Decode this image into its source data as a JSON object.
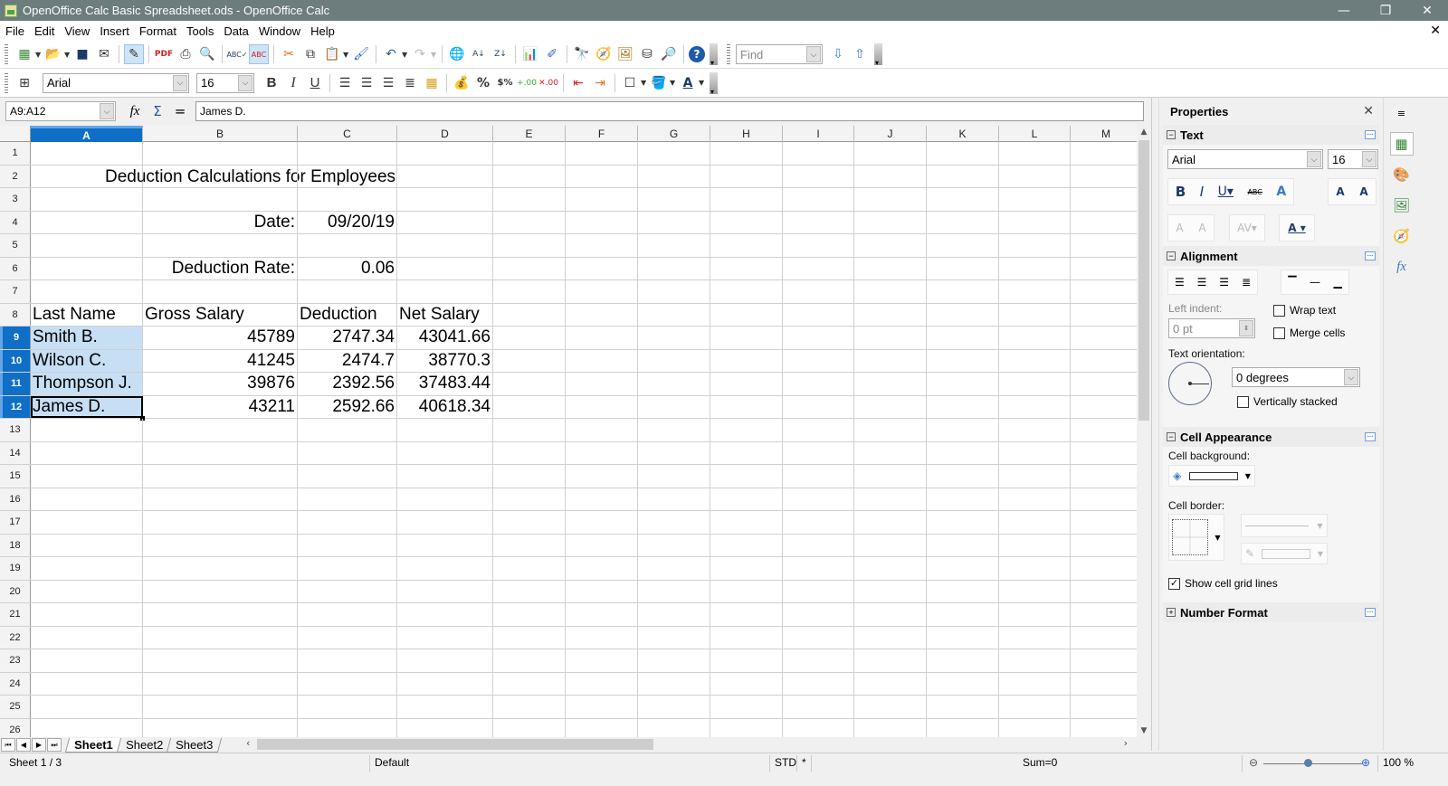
{
  "window": {
    "title": "OpenOffice Calc Basic Spreadsheet.ods - OpenOffice Calc",
    "minimize": "—",
    "restore": "❐",
    "close": "✕",
    "doc_close": "✕"
  },
  "menu": [
    "File",
    "Edit",
    "View",
    "Insert",
    "Format",
    "Tools",
    "Data",
    "Window",
    "Help"
  ],
  "toolbar_standard": {
    "icons": [
      "new-icon",
      "open-icon",
      "save-icon",
      "email-icon",
      "edit-mode-icon",
      "export-pdf-icon",
      "print-icon",
      "print-preview-icon",
      "spellcheck-icon",
      "autospellcheck-icon",
      "cut-icon",
      "copy-icon",
      "paste-icon",
      "format-paintbrush-icon",
      "undo-icon",
      "redo-icon",
      "hyperlink-icon",
      "sort-ascending-icon",
      "sort-descending-icon",
      "chart-icon",
      "show-draw-functions-icon",
      "find-replace-icon",
      "navigator-icon",
      "gallery-icon",
      "data-sources-icon",
      "zoom-icon",
      "help-icon"
    ],
    "find_placeholder": "Find"
  },
  "toolbar_formatting": {
    "font_name": "Arial",
    "font_size": "16",
    "bold": "B",
    "italic": "I",
    "underline": "U"
  },
  "formula_bar": {
    "name_box": "A9:A12",
    "function_wizard": "fx",
    "sum": "Σ",
    "equals": "=",
    "content": "James D."
  },
  "sheet": {
    "columns": [
      "A",
      "B",
      "C",
      "D",
      "E",
      "F",
      "G",
      "H",
      "I",
      "J",
      "K",
      "L",
      "M"
    ],
    "selected_column": "A",
    "selected_rows": [
      9,
      10,
      11,
      12
    ],
    "row_count": 26,
    "title": "Deduction Calculations for Employees",
    "date_label": "Date:",
    "date_value": "09/20/19",
    "rate_label": "Deduction Rate:",
    "rate_value": "0.06",
    "headers": [
      "Last Name",
      "Gross Salary",
      "Deduction",
      "Net Salary"
    ],
    "employees": [
      {
        "name": "Smith B.",
        "gross": "45789",
        "deduction": "2747.34",
        "net": "43041.66"
      },
      {
        "name": "Wilson C.",
        "gross": "41245",
        "deduction": "2474.7",
        "net": "38770.3"
      },
      {
        "name": "Thompson J.",
        "gross": "39876",
        "deduction": "2392.56",
        "net": "37483.44"
      },
      {
        "name": "James D.",
        "gross": "43211",
        "deduction": "2592.66",
        "net": "40618.34"
      }
    ]
  },
  "tabs": [
    "Sheet1",
    "Sheet2",
    "Sheet3"
  ],
  "active_tab": "Sheet1",
  "status": {
    "sheet": "Sheet 1 / 3",
    "page_style": "Default",
    "mode": "STD",
    "modified": "*",
    "sum": "Sum=0",
    "zoom": "100 %",
    "zoom_level": 100
  },
  "sidebar": {
    "title": "Properties",
    "text_section": {
      "title": "Text",
      "font": "Arial",
      "size": "16"
    },
    "alignment_section": {
      "title": "Alignment",
      "left_indent_label": "Left indent:",
      "left_indent_value": "0 pt",
      "wrap_text": "Wrap text",
      "wrap_text_checked": false,
      "merge_cells": "Merge cells",
      "merge_cells_checked": false,
      "text_orientation_label": "Text orientation:",
      "orientation_value": "0 degrees",
      "vertically_stacked": "Vertically stacked",
      "vertically_stacked_checked": false
    },
    "cell_appearance_section": {
      "title": "Cell Appearance",
      "background_label": "Cell background:",
      "border_label": "Cell border:",
      "show_grid": "Show cell grid lines",
      "show_grid_checked": true
    },
    "number_format_section": {
      "title": "Number Format"
    }
  }
}
